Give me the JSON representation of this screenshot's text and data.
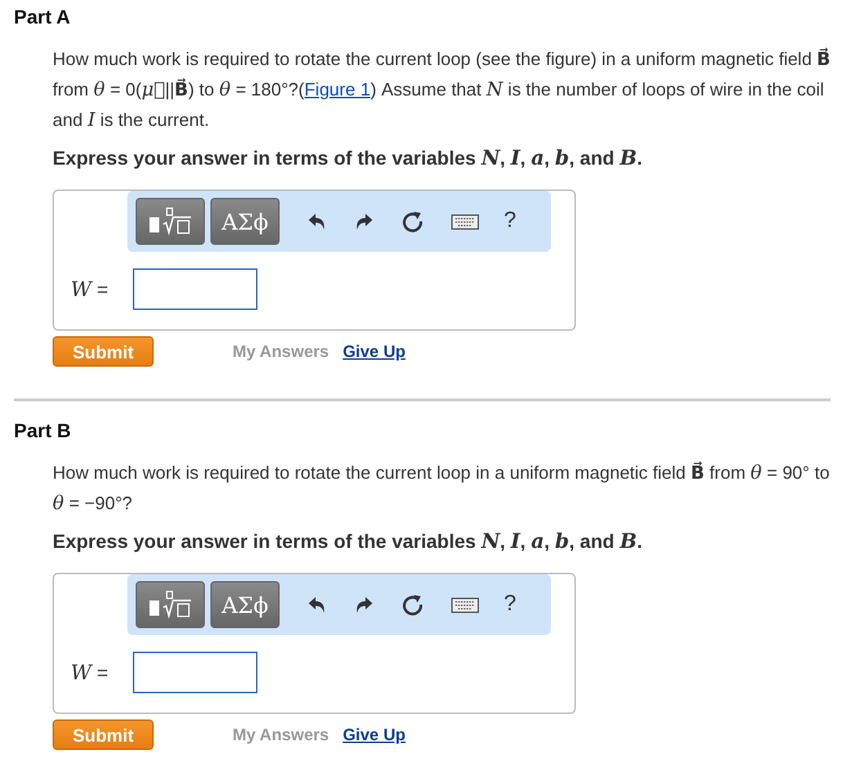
{
  "parts": [
    {
      "title": "Part A",
      "question": [
        {
          "kind": "text",
          "text": "How much work is required to rotate the current loop (see the figure) in a uniform magnetic field **B⃗** from *θ* = 0(*μ⃗*||**B⃗**) to *θ* = 180°?("
        },
        {
          "kind": "link",
          "text": "Figure 1"
        },
        {
          "kind": "text",
          "text": ") Assume that *N* is the number of loops of wire in the coil and *I* is the current."
        }
      ],
      "instruction": "Express your answer in terms of the variables *N*, *I*, *a*, *b*, and *B*.",
      "toolbar": [
        {
          "kind": "templates"
        },
        {
          "kind": "symbols",
          "label": "ΑΣϕ"
        },
        {
          "kind": "undo"
        },
        {
          "kind": "redo"
        },
        {
          "kind": "reset"
        },
        {
          "kind": "keyboard"
        },
        {
          "kind": "help",
          "label": "?"
        }
      ],
      "answer_label": "*W* =",
      "submit": "Submit",
      "links": [
        {
          "text": "My Answers",
          "disabled": true
        },
        {
          "text": "Give Up",
          "disabled": false
        }
      ]
    },
    {
      "title": "Part B",
      "question": [
        {
          "kind": "text",
          "text": "How much work is required to rotate the current loop in a uniform magnetic field **B⃗** from *θ* = 90° to *θ* = −90°?"
        }
      ],
      "instruction": "Express your answer in terms of the variables *N*, *I*, *a*, *b*, and *B*.",
      "toolbar": [
        {
          "kind": "templates"
        },
        {
          "kind": "symbols",
          "label": "ΑΣϕ"
        },
        {
          "kind": "undo"
        },
        {
          "kind": "redo"
        },
        {
          "kind": "reset"
        },
        {
          "kind": "keyboard"
        },
        {
          "kind": "help",
          "label": "?"
        }
      ],
      "answer_label": "*W* =",
      "submit": "Submit",
      "links": [
        {
          "text": "My Answers",
          "disabled": true
        },
        {
          "text": "Give Up",
          "disabled": false
        }
      ]
    }
  ]
}
